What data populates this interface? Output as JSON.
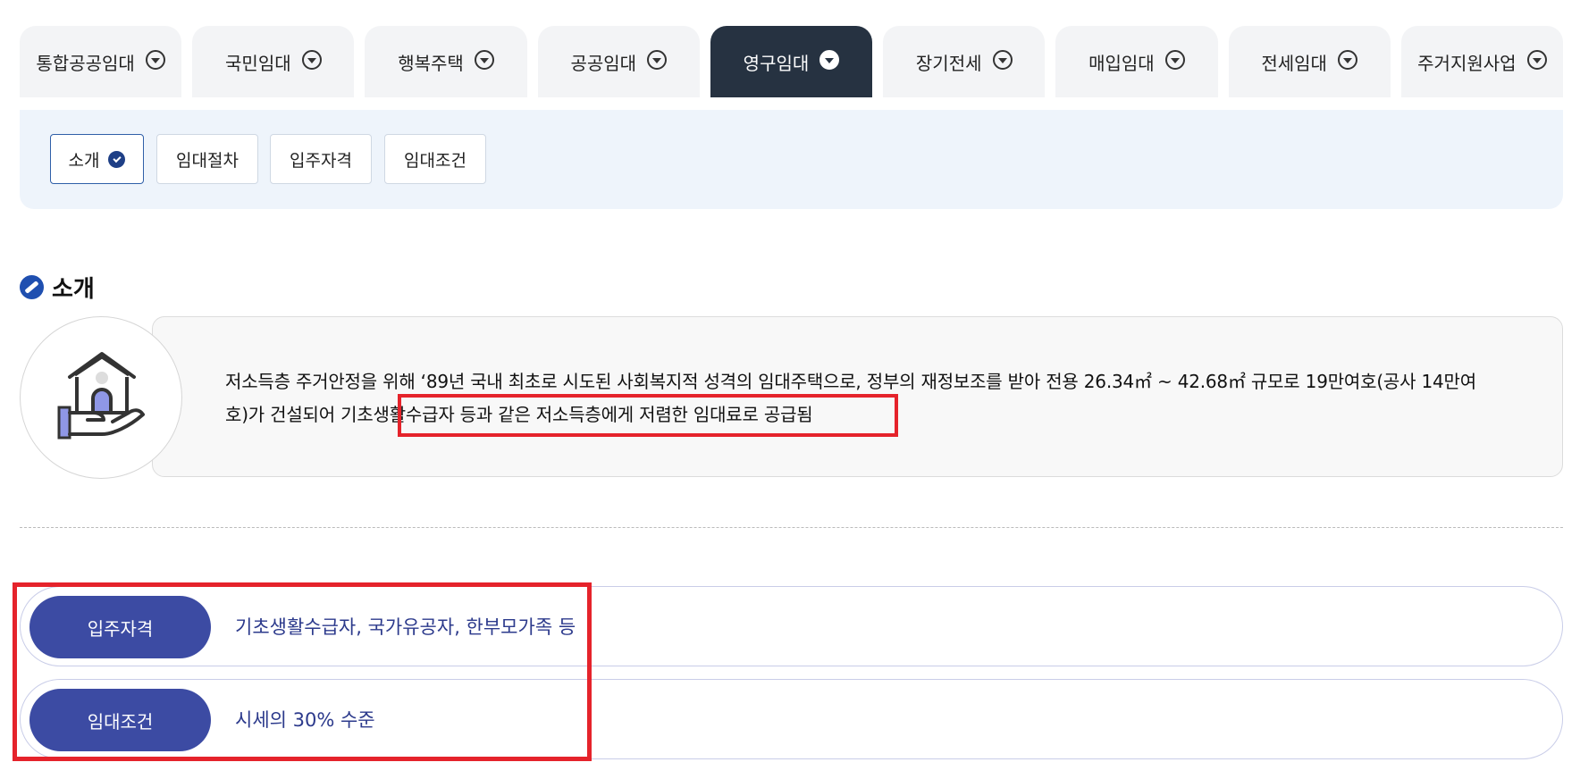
{
  "tabs": [
    {
      "label": "통합공공임대",
      "active": false
    },
    {
      "label": "국민임대",
      "active": false
    },
    {
      "label": "행복주택",
      "active": false
    },
    {
      "label": "공공임대",
      "active": false
    },
    {
      "label": "영구임대",
      "active": true
    },
    {
      "label": "장기전세",
      "active": false
    },
    {
      "label": "매입임대",
      "active": false
    },
    {
      "label": "전세임대",
      "active": false
    },
    {
      "label": "주거지원사업",
      "active": false
    }
  ],
  "subtabs": [
    {
      "label": "소개",
      "active": true
    },
    {
      "label": "임대절차",
      "active": false
    },
    {
      "label": "입주자격",
      "active": false
    },
    {
      "label": "임대조건",
      "active": false
    }
  ],
  "section": {
    "title": "소개",
    "text_part1": "저소득층 주거안정을 위해 ‘89년 국내 최초로 시도된 사회복지적 성격의 임대주택으로, 정부의 재정보조를 받아 전용 26.34㎡ ~ 42.68㎡ 규모로 19만여호(공사 14만여호)가 건설되어 ",
    "text_highlight": "기초생활수급자 등과 같은 저소득층에게 저렴한 임대료로 공급됨"
  },
  "summary": [
    {
      "label": "입주자격",
      "value": "기초생활수급자, 국가유공자, 한부모가족 등"
    },
    {
      "label": "임대조건",
      "value": "시세의 30% 수준"
    }
  ],
  "colors": {
    "active_tab": "#263241",
    "pill_label": "#3c4ba3",
    "highlight_border": "#e5232b",
    "subbar_bg": "#eef4fb"
  }
}
